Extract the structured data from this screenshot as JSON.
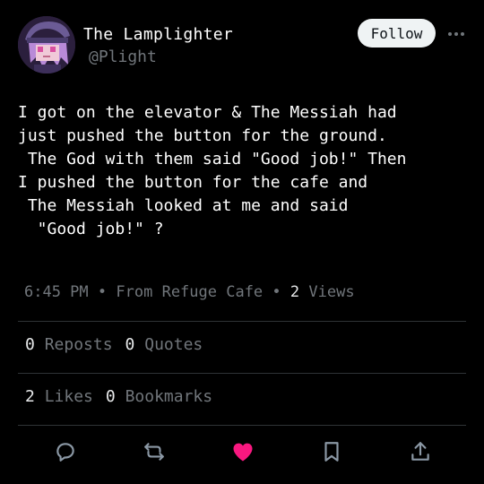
{
  "author": {
    "display_name": "The Lamplighter",
    "handle": "@Plight"
  },
  "header": {
    "follow_label": "Follow"
  },
  "post": {
    "text": "I got on the elevator & The Messiah had\njust pushed the button for the ground.\n The God with them said \"Good job!\" Then\nI pushed the button for the cafe and\n The Messiah looked at me and said\n  \"Good job!\" ?"
  },
  "meta": {
    "time": "6:45 PM",
    "separator": "•",
    "source": "From Refuge Cafe",
    "views_count": "2",
    "views_label": "Views"
  },
  "stats": {
    "reposts_count": "0",
    "reposts_label": "Reposts",
    "quotes_count": "0",
    "quotes_label": "Quotes",
    "likes_count": "2",
    "likes_label": "Likes",
    "bookmarks_count": "0",
    "bookmarks_label": "Bookmarks"
  },
  "actions": [
    "reply-icon",
    "repost-icon",
    "like-icon",
    "bookmark-icon",
    "share-icon"
  ],
  "colors": {
    "background": "#000000",
    "text": "#ffffff",
    "muted": "#71767b",
    "like_active": "#f91880",
    "divider": "#2f3336",
    "follow_bg": "#eff3f4"
  }
}
